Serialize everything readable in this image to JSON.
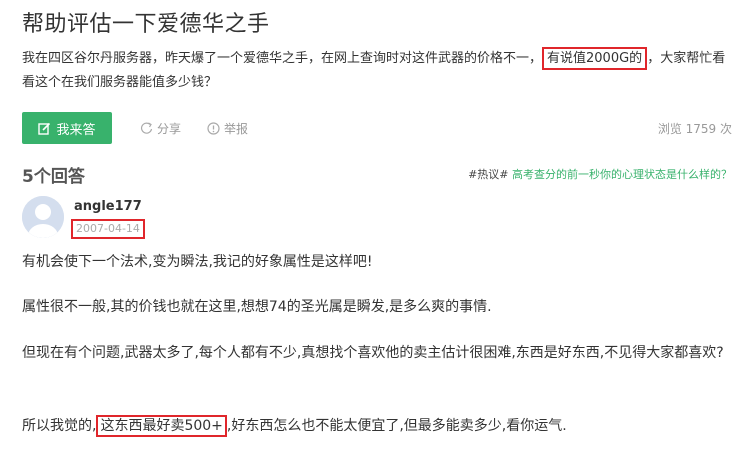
{
  "question": {
    "title": "帮助评估一下爱德华之手",
    "body_prefix": "我在四区谷尔丹服务器，昨天爆了一个爱德华之手，在网上查询时对这件武器的价格不一，",
    "body_highlight": "有说值2000G的",
    "body_suffix": "，大家帮忙看看这个在我们服务器能值多少钱？"
  },
  "actions": {
    "answer_button": "我来答",
    "share": "分享",
    "report": "举报",
    "views": "浏览 1759 次"
  },
  "answers_header": {
    "count": "5个回答",
    "hot_tag": "#热议#",
    "hot_link": "高考查分的前一秒你的心理状态是什么样的？"
  },
  "answer": {
    "username": "angle177",
    "date": "2007-04-14",
    "paragraphs": {
      "p1": "有机会使下一个法术,变为瞬法,我记的好象属性是这样吧!",
      "p2": "属性很不一般,其的价钱也就在这里,想想74的圣光属是瞬发,是多么爽的事情.",
      "p3": "但现在有个问题,武器太多了,每个人都有不少,真想找个喜欢他的卖主估计很困难,东西是好东西,不见得大家都喜欢?",
      "p4_prefix": "所以我觉的,",
      "p4_highlight": "这东西最好卖500+",
      "p4_suffix": ",好东西怎么也不能太便宜了,但最多能卖多少,看你运气."
    }
  },
  "colors": {
    "accent_green": "#38b26c",
    "highlight_red": "#e0262b"
  },
  "icons": {
    "answer": "edit-icon",
    "share": "share-icon",
    "report": "report-icon",
    "avatar": "default-avatar-icon"
  }
}
